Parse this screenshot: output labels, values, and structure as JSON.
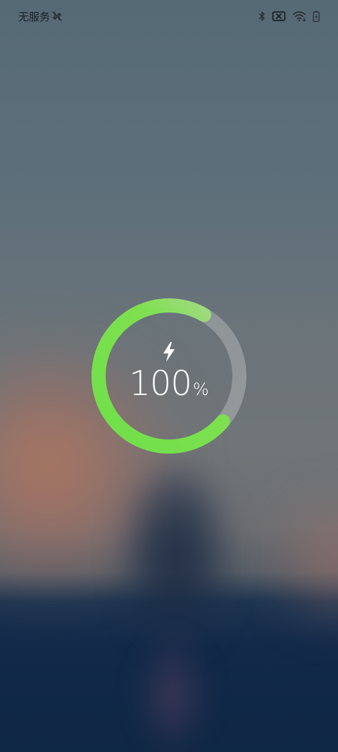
{
  "status_bar": {
    "carrier": "无服务",
    "icons": {
      "left": [
        "no-data-icon"
      ],
      "right": [
        "bluetooth-icon",
        "no-sim-icon",
        "wifi-icon",
        "battery-charging-icon"
      ]
    }
  },
  "charging": {
    "level_percent": 100,
    "value": "100",
    "unit": "%",
    "icon": "lightning-bolt-icon",
    "colors": {
      "progress": "#7ee04e",
      "track": "#9aa0a4",
      "text": "#ffffff"
    }
  }
}
